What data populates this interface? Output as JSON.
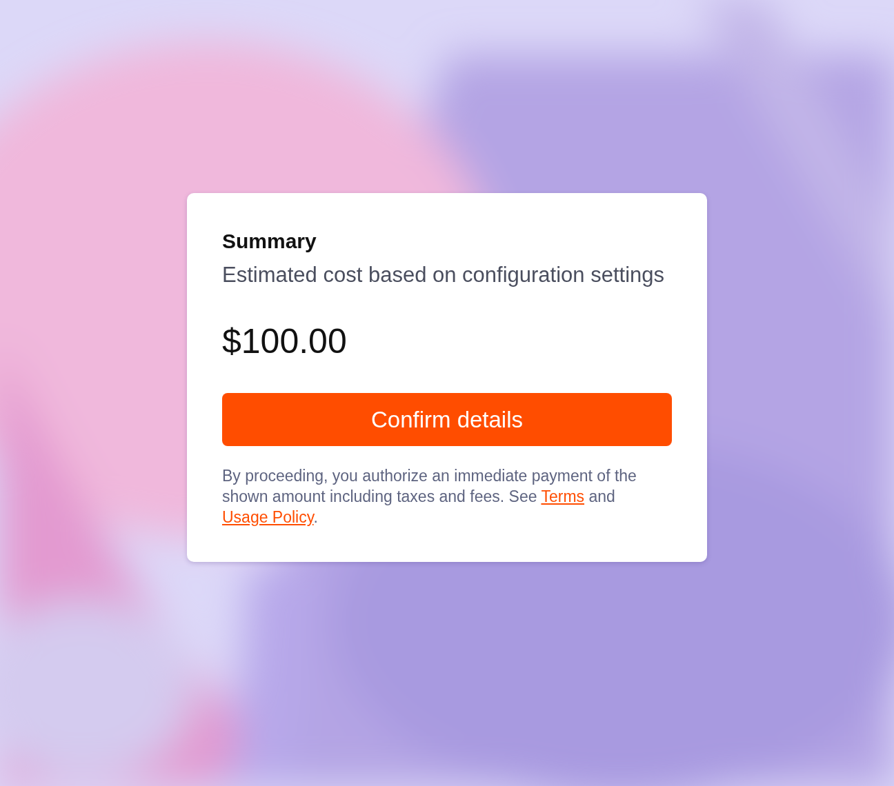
{
  "card": {
    "title": "Summary",
    "subtitle": "Estimated cost based on configuration settings",
    "price": "$100.00",
    "button": "Confirm details",
    "disclaimer": [
      {
        "kind": "text",
        "text": "By proceeding, you authorize an immediate payment of the shown amount including taxes and fees. See "
      },
      {
        "kind": "link",
        "text": "Terms"
      },
      {
        "kind": "text",
        "text": " and "
      },
      {
        "kind": "link",
        "text": "Usage Policy"
      },
      {
        "kind": "text",
        "text": "."
      }
    ]
  }
}
